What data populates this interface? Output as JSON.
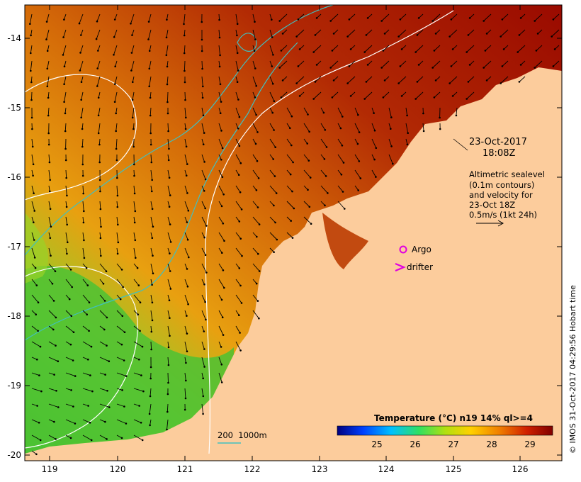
{
  "map": {
    "date": "23-Oct-2017",
    "time": "18:08Z",
    "legend_lines": [
      "Altimetric sealevel",
      "(0.1m contours)",
      "and velocity for",
      "23-Oct 18Z",
      "0.5m/s (1kt 24h)"
    ],
    "argo_label": "Argo",
    "drifter_label": "drifter",
    "bathymetry_label": "200  1000m",
    "colorbar": {
      "title": "Temperature (°C) n19 14% ql>=4",
      "ticks": [
        "25",
        "26",
        "27",
        "28",
        "29"
      ]
    },
    "credit": "© IMOS 31-Oct-2017 04:29:56 Hobart time",
    "x_axis_labels": [
      "119",
      "120",
      "121",
      "122",
      "123",
      "124",
      "125",
      "126"
    ],
    "y_axis_labels": [
      "-14",
      "-15",
      "-16",
      "-17",
      "-18",
      "-19",
      "-20"
    ],
    "colors": {
      "land": "#fccc9c",
      "argo_marker": "#e000e0",
      "bathymetry_line": "#40c0c0",
      "contour_line": "#ffffff"
    }
  }
}
